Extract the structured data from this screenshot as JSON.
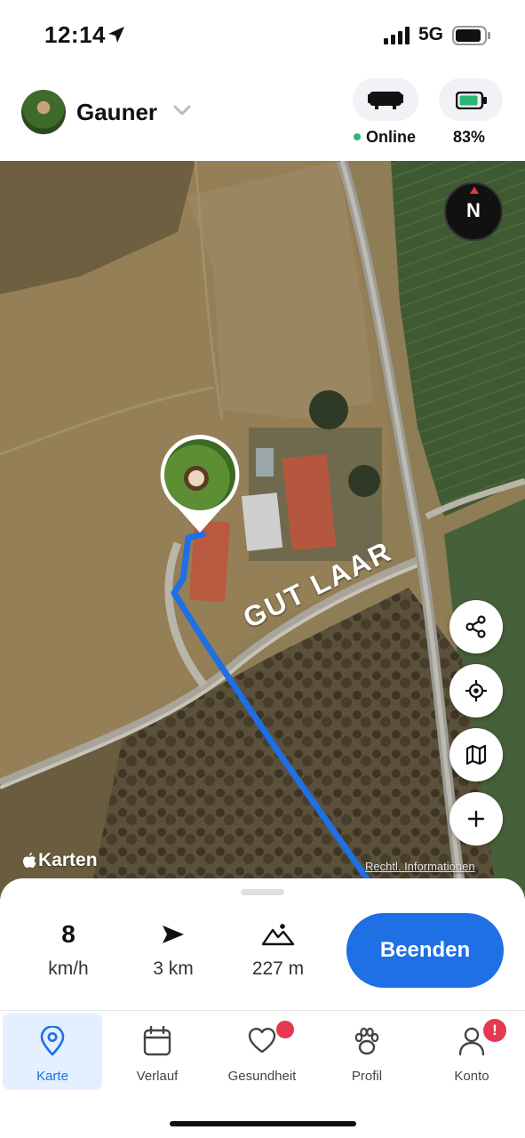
{
  "status_bar": {
    "time": "12:14",
    "network": "5G"
  },
  "header": {
    "pet_name": "Gauner",
    "device_status": "Online",
    "battery": "83%",
    "online_color": "#2bb673"
  },
  "map": {
    "road_label": "GUT LAAR",
    "compass_label": "N",
    "attribution": "Karten",
    "legal_link": "Rechtl. Informationen",
    "route_color": "#1f6fe5",
    "controls": [
      "share-icon",
      "locate-icon",
      "map-layers-icon",
      "zoom-in-icon"
    ]
  },
  "trip": {
    "speed_value": "8",
    "speed_unit": "km/h",
    "distance_value": "3 km",
    "elevation_value": "227 m",
    "stop_label": "Beenden"
  },
  "tabs": [
    {
      "label": "Karte",
      "icon": "map-pin-icon",
      "active": true
    },
    {
      "label": "Verlauf",
      "icon": "calendar-icon"
    },
    {
      "label": "Gesundheit",
      "icon": "heart-icon",
      "badge": "dot"
    },
    {
      "label": "Profil",
      "icon": "paw-icon"
    },
    {
      "label": "Konto",
      "icon": "person-icon",
      "badge": "!"
    }
  ],
  "colors": {
    "accent": "#1f6fe5",
    "badge": "#e53950"
  }
}
